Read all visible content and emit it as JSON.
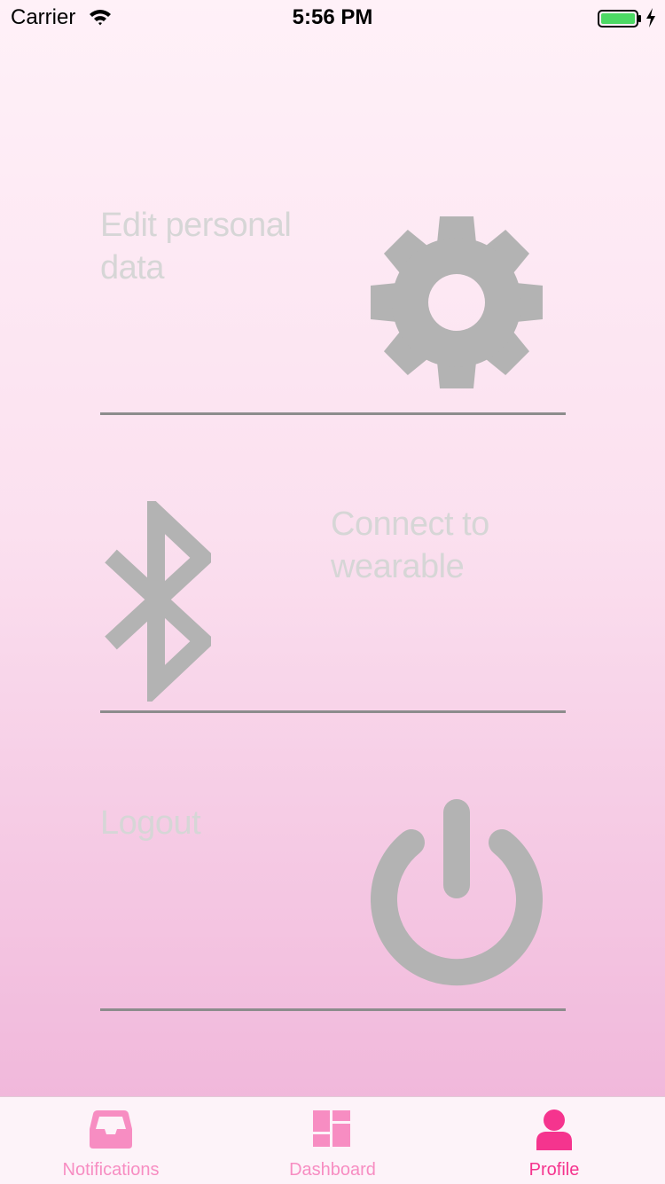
{
  "status_bar": {
    "carrier": "Carrier",
    "time": "5:56 PM"
  },
  "settings": [
    {
      "label": "Edit personal data",
      "icon": "gear-icon"
    },
    {
      "label": "Connect to wearable",
      "icon": "bluetooth-icon"
    },
    {
      "label": "Logout",
      "icon": "power-icon"
    }
  ],
  "tabs": [
    {
      "label": "Notifications",
      "icon": "inbox-icon",
      "selected": false
    },
    {
      "label": "Dashboard",
      "icon": "dashboard-icon",
      "selected": false
    },
    {
      "label": "Profile",
      "icon": "user-icon",
      "selected": true
    }
  ],
  "colors": {
    "accent": "#f5348e",
    "tab_inactive": "#f78dc2",
    "icon_gray": "#b3b3b3",
    "label_gray": "#d6d6d6",
    "divider": "#8c8c8c",
    "battery_green": "#4cd964"
  }
}
